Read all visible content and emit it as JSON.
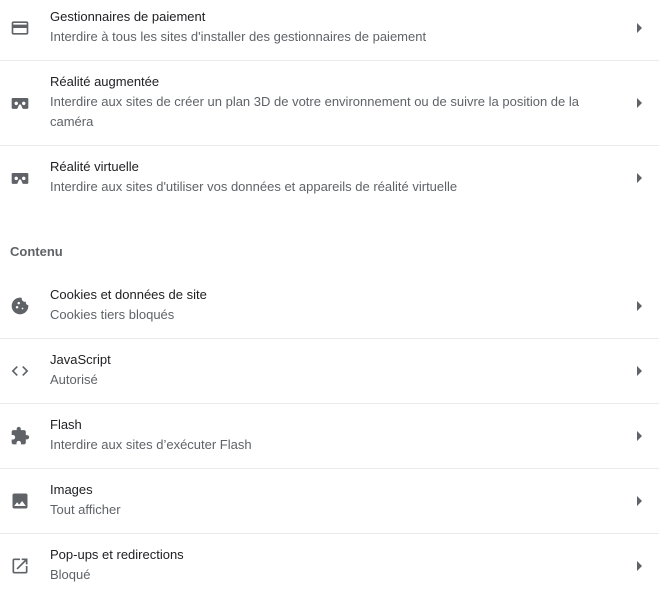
{
  "rows_top": [
    {
      "icon": "credit-card-icon",
      "title": "Gestionnaires de paiement",
      "desc": "Interdire à tous les sites d'installer des gestionnaires de paiement"
    },
    {
      "icon": "vr-headset-icon",
      "title": "Réalité augmentée",
      "desc": "Interdire aux sites de créer un plan 3D de votre environnement ou de suivre la position de la caméra"
    },
    {
      "icon": "vr-headset-icon",
      "title": "Réalité virtuelle",
      "desc": "Interdire aux sites d'utiliser vos données et appareils de réalité virtuelle"
    }
  ],
  "section": {
    "title": "Contenu"
  },
  "rows_content": [
    {
      "icon": "cookie-icon",
      "title": "Cookies et données de site",
      "desc": "Cookies tiers bloqués"
    },
    {
      "icon": "code-icon",
      "title": "JavaScript",
      "desc": "Autorisé"
    },
    {
      "icon": "puzzle-icon",
      "title": "Flash",
      "desc": "Interdire aux sites d’exécuter Flash"
    },
    {
      "icon": "image-icon",
      "title": "Images",
      "desc": "Tout afficher"
    },
    {
      "icon": "open-in-new-icon",
      "title": "Pop-ups et redirections",
      "desc": "Bloqué"
    }
  ],
  "colors": {
    "icon": "#5f6368",
    "divider": "#e8eaed",
    "title": "#202124",
    "secondary": "#5f6368"
  }
}
